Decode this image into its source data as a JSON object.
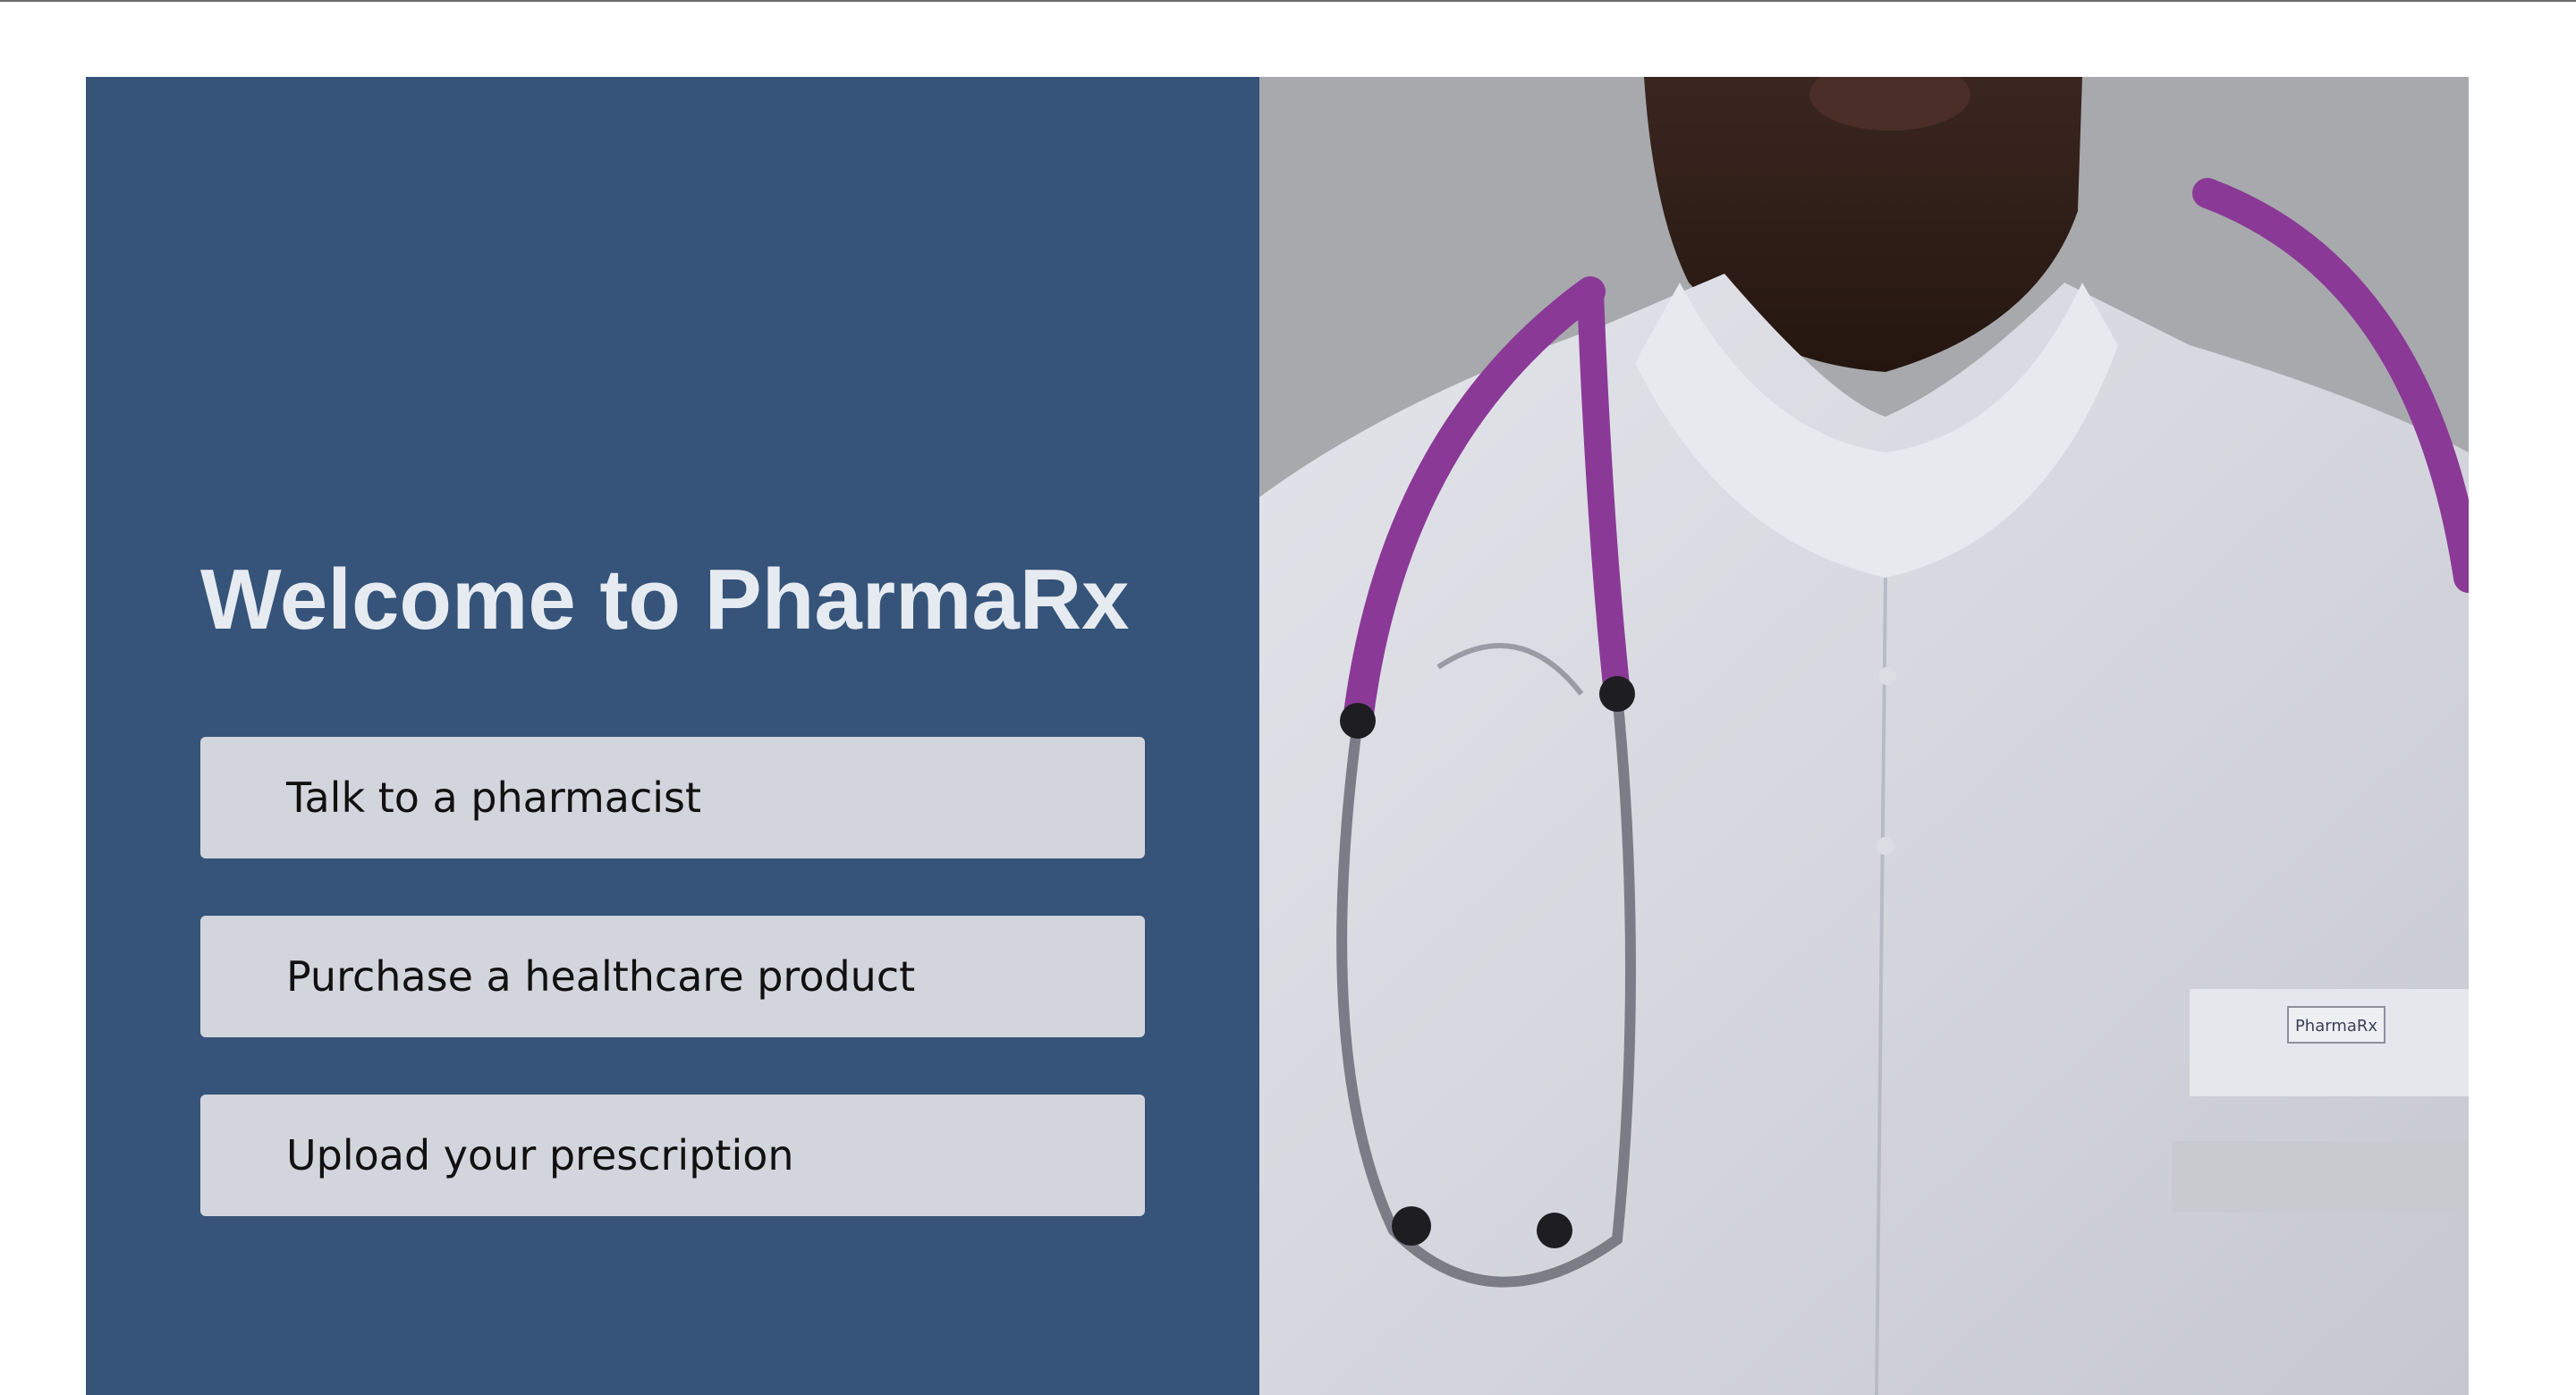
{
  "hero": {
    "title": "Welcome to PharmaRx",
    "actions": [
      {
        "label": "Talk to a pharmacist"
      },
      {
        "label": "Purchase a healthcare product"
      },
      {
        "label": "Upload your prescription"
      }
    ]
  },
  "photo": {
    "subject": "pharmacist-in-white-coat-with-stethoscope",
    "badge_text": "PharmaRx"
  },
  "colors": {
    "panel_background": "#365479",
    "title_text": "#e6ebf2",
    "button_background": "#d2d5dc",
    "button_text": "#111111",
    "stethoscope": "#8a3a96"
  }
}
